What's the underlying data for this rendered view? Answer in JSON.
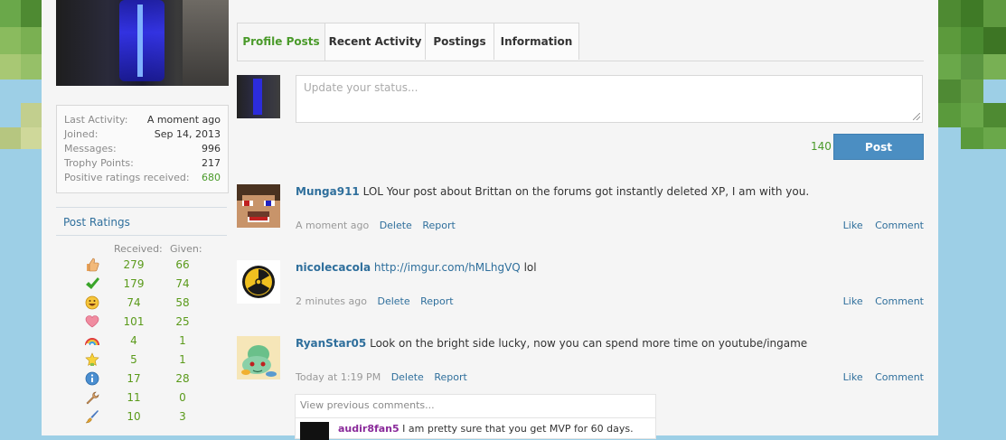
{
  "colors": {
    "accent_green": "#4a9a2a",
    "link_blue": "#2f6f9c",
    "button_blue": "#4b8ec2",
    "page_bg": "#f5f5f5",
    "sky": "#9dcfe6"
  },
  "sidebar": {
    "stats": [
      {
        "label": "Last Activity:",
        "value": "A moment ago"
      },
      {
        "label": "Joined:",
        "value": "Sep 14, 2013"
      },
      {
        "label": "Messages:",
        "value": "996"
      },
      {
        "label": "Trophy Points:",
        "value": "217"
      },
      {
        "label": "Positive ratings received:",
        "value": "680"
      }
    ],
    "ratings_title": "Post Ratings",
    "ratings_headers": {
      "received": "Received:",
      "given": "Given:"
    },
    "ratings": [
      {
        "icon": "thumbs-up-icon",
        "received": "279",
        "given": "66"
      },
      {
        "icon": "checkmark-icon",
        "received": "179",
        "given": "74"
      },
      {
        "icon": "funny-face-icon",
        "received": "74",
        "given": "58"
      },
      {
        "icon": "heart-icon",
        "received": "101",
        "given": "25"
      },
      {
        "icon": "rainbow-icon",
        "received": "4",
        "given": "1"
      },
      {
        "icon": "winner-star-icon",
        "received": "5",
        "given": "1"
      },
      {
        "icon": "info-icon",
        "received": "17",
        "given": "28"
      },
      {
        "icon": "wrench-icon",
        "received": "11",
        "given": "0"
      },
      {
        "icon": "paintbrush-icon",
        "received": "10",
        "given": "3"
      }
    ]
  },
  "tabs": [
    {
      "label": "Profile Posts",
      "active": true
    },
    {
      "label": "Recent Activity",
      "active": false
    },
    {
      "label": "Postings",
      "active": false
    },
    {
      "label": "Information",
      "active": false
    }
  ],
  "status": {
    "placeholder": "Update your status...",
    "counter": "140",
    "post_label": "Post"
  },
  "posts": [
    {
      "user": "Munga911",
      "text": "LOL Your post about Brittan on the forums got instantly deleted XP, I am with you.",
      "time": "A moment ago",
      "delete": "Delete",
      "report": "Report",
      "like": "Like",
      "comment": "Comment"
    },
    {
      "user": "nicolecacola",
      "link": "http://imgur.com/hMLhgVQ",
      "text": "lol",
      "time": "2 minutes ago",
      "delete": "Delete",
      "report": "Report",
      "like": "Like",
      "comment": "Comment"
    },
    {
      "user": "RyanStar05",
      "text": "Look on the bright side lucky, now you can spend more time on youtube/ingame",
      "time": "Today at 1:19 PM",
      "delete": "Delete",
      "report": "Report",
      "like": "Like",
      "comment": "Comment"
    }
  ],
  "comments": {
    "view_previous": "View previous comments...",
    "items": [
      {
        "user": "audir8fan5",
        "text": "I am pretty sure that you get MVP for 60 days."
      }
    ]
  }
}
